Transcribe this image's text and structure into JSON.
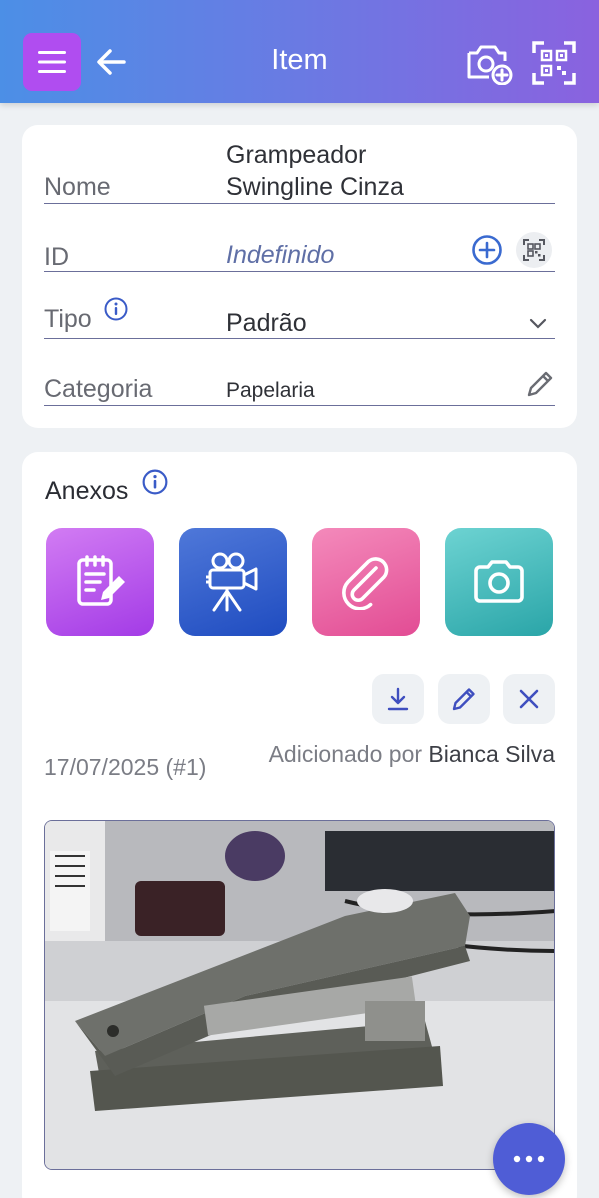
{
  "header": {
    "title": "Item",
    "icons": [
      "menu-icon",
      "back-arrow-icon",
      "camera-add-icon",
      "qr-scan-icon"
    ]
  },
  "details": {
    "nome_label": "Nome",
    "nome_value_line1": "Grampeador",
    "nome_value_line2": "Swingline Cinza",
    "id_label": "ID",
    "id_value": "Indefinido",
    "tipo_label": "Tipo",
    "tipo_value": "Padrão",
    "categoria_label": "Categoria",
    "categoria_value": "Papelaria"
  },
  "attachments": {
    "title": "Anexos",
    "buttons": [
      "note-icon",
      "video-camera-icon",
      "paperclip-icon",
      "camera-icon"
    ],
    "entry": {
      "date": "17/07/2025 (#1)",
      "added_by_prefix": "Adicionado por",
      "added_by_name": "Bianca Silva",
      "actions": [
        "download-icon",
        "edit-icon",
        "delete-icon"
      ]
    }
  },
  "colors": {
    "header_start": "#4c8fe6",
    "header_end": "#8a62df",
    "menu_button": "#b04df0",
    "accent": "#4f5dd6",
    "link_blue": "#3a6ad0"
  }
}
